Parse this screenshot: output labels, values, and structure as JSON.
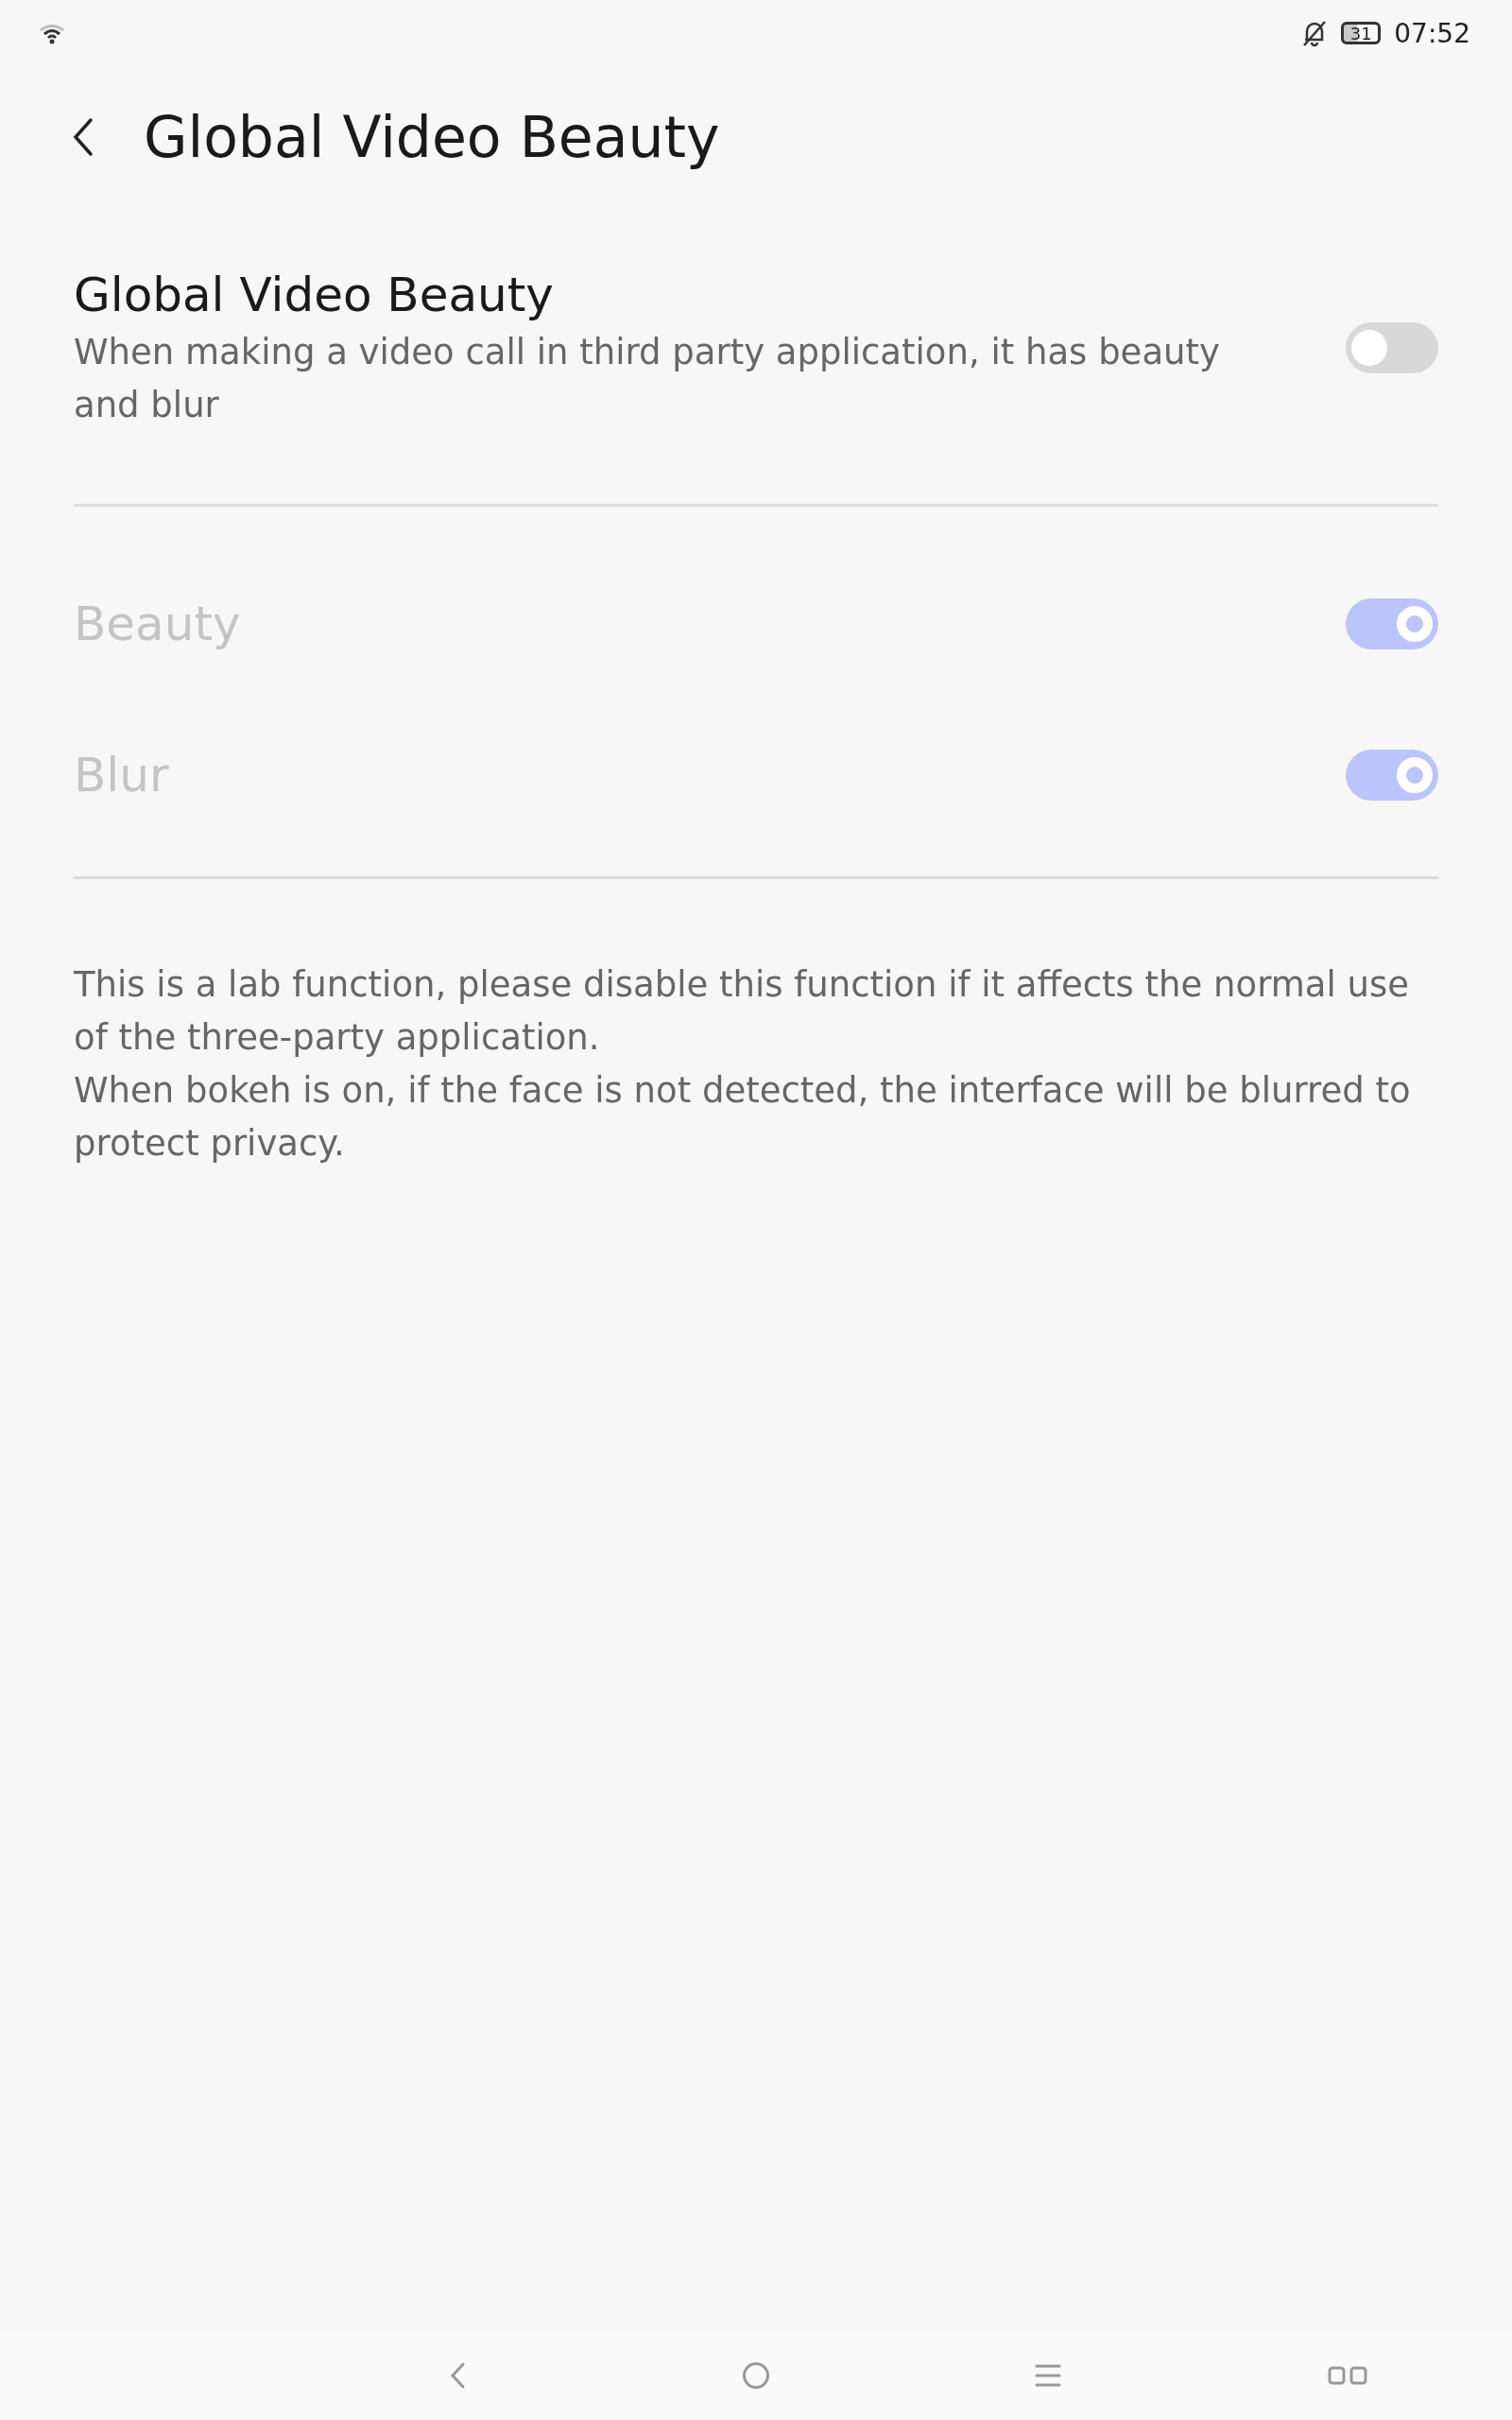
{
  "status_bar": {
    "battery": "31",
    "time": "07:52"
  },
  "header": {
    "title": "Global Video Beauty"
  },
  "main_setting": {
    "title": "Global Video Beauty",
    "description": "When making a video call in third party application, it has beauty and blur",
    "checked": false,
    "disabled": false
  },
  "options": [
    {
      "label": "Beauty",
      "checked": true,
      "disabled": true
    },
    {
      "label": "Blur",
      "checked": true,
      "disabled": true
    }
  ],
  "notes": [
    "This is a lab function, please disable this function if it affects the normal use of the three-party application.",
    "When bokeh is on, if the face is not detected, the interface will be blurred to protect privacy."
  ]
}
